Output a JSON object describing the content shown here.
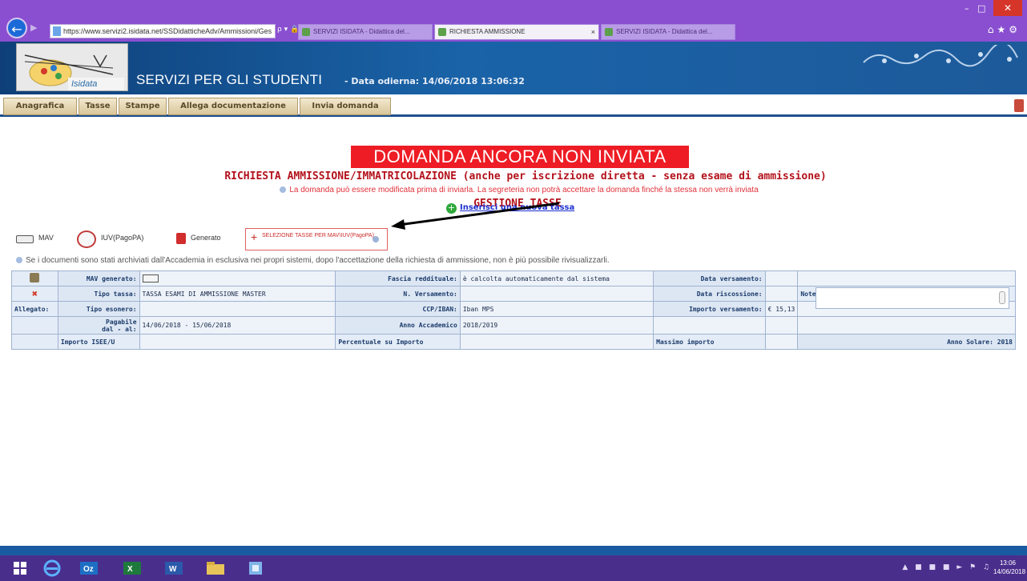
{
  "browser": {
    "address": "https://www.servizi2.isidata.net/SSDidatticheAdv/Ammissioni/Ges",
    "addr_tools": "ρ ▾ 🔒 C",
    "tabs": [
      {
        "label": "SERVIZI ISIDATA - Didattica del...",
        "active": false
      },
      {
        "label": "RICHIESTA AMMISSIONE",
        "active": true
      },
      {
        "label": "SERVIZI ISIDATA - Didattica del...",
        "active": false
      }
    ],
    "close_glyph": "×"
  },
  "header": {
    "logo_text": "Isidata",
    "title": "SERVIZI PER GLI STUDENTI",
    "date_line": "- Data odierna: 14/06/2018 13:06:32"
  },
  "nav": {
    "tabs": [
      "Anagrafica",
      "Tasse",
      "Stampe",
      "Allega documentazione",
      "Invia domanda"
    ]
  },
  "main": {
    "status_banner": "DOMANDA ANCORA NON INVIATA",
    "request_title": "RICHIESTA AMMISSIONE/IMMATRICOLAZIONE (anche per iscrizione diretta - senza esame di ammissione)",
    "request_note": "La domanda può essere modificata prima di inviarla. La segreteria non potrà accettare la domanda finché la stessa non verrà inviata",
    "section_title": "GESTIONE TASSE",
    "insert_link": "Inserisci una nuova tassa",
    "toolbar": {
      "mav": "MAV",
      "iuv": "IUV(PagoPA)",
      "generato": "Generato",
      "select_btn": "SELEZIONE TASSE PER MAV\\IUV(PagoPA)"
    },
    "archive_note": "Se i documenti sono stati archiviati dall'Accademia in esclusiva nei propri sistemi, dopo l'accettazione della richiesta di ammissione, non è più possibile rivisualizzarli."
  },
  "table": {
    "allegato_label": "Allegato:",
    "mav_generato_label": "MAV generato:",
    "fascia_label": "Fascia reddituale:",
    "fascia_value": "è calcolta automaticamente dal sistema",
    "data_versamento_label": "Data versamento:",
    "tipo_tassa_label": "Tipo tassa:",
    "tipo_tassa_value": "TASSA ESAMI DI AMMISSIONE MASTER",
    "n_versamento_label": "N. Versamento:",
    "data_riscossione_label": "Data riscossione:",
    "note_label": "Note:",
    "tipo_esonero_label": "Tipo esonero:",
    "ccp_label": "CCP/IBAN:",
    "ccp_value": "Iban MPS",
    "importo_versamento_label": "Importo versamento:",
    "importo_versamento_value": "€ 15,13",
    "pagabile_label_1": "Pagabile",
    "pagabile_label_2": "dal - al:",
    "pagabile_value": "14/06/2018 - 15/06/2018",
    "anno_accademico_label": "Anno Accademico",
    "anno_accademico_value": "2018/2019",
    "importo_isee_label": "Importo ISEE/U",
    "percentuale_label": "Percentuale su Importo",
    "massimo_label": "Massimo importo",
    "anno_solare_label": "Anno Solare:",
    "anno_solare_value": "2018"
  },
  "taskbar": {
    "clock_time": "13:06",
    "clock_date": "14/06/2018"
  },
  "colors": {
    "banner_red": "#ee1c24",
    "title_red": "#b3111b",
    "header_blue": "#1a63a8",
    "taskbar_purple": "#4a2e8c"
  }
}
